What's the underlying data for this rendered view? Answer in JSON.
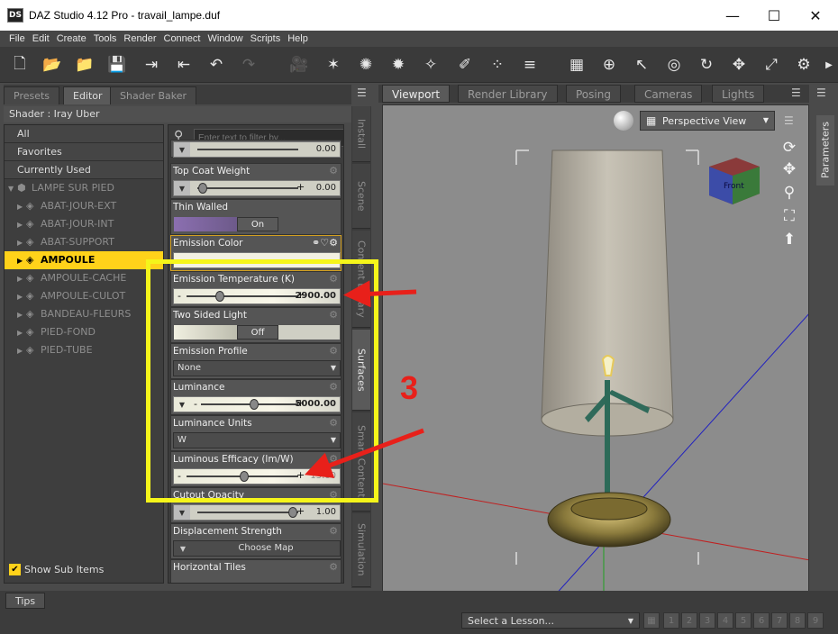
{
  "window": {
    "app_icon": "DS",
    "title": "DAZ Studio 4.12 Pro - travail_lampe.duf",
    "minimize": "—",
    "maximize": "☐",
    "close": "✕"
  },
  "menu": [
    "File",
    "Edit",
    "Create",
    "Tools",
    "Render",
    "Connect",
    "Window",
    "Scripts",
    "Help"
  ],
  "left_tabs": [
    "Presets",
    "Editor",
    "Shader Baker"
  ],
  "shader": "Shader : Iray Uber",
  "tree": {
    "headers": [
      "All",
      "Favorites",
      "Currently Used"
    ],
    "root": "LAMPE SUR PIED",
    "items": [
      "ABAT-JOUR-EXT",
      "ABAT-JOUR-INT",
      "ABAT-SUPPORT",
      "AMPOULE",
      "AMPOULE-CACHE",
      "AMPOULE-CULOT",
      "BANDEAU-FLEURS",
      "PIED-FOND",
      "PIED-TUBE"
    ],
    "selected": "AMPOULE",
    "show_sub_items": "Show Sub Items"
  },
  "filter_placeholder": "Enter text to filter by...",
  "properties": {
    "top_value": "0.00",
    "top_coat_weight": {
      "label": "Top Coat Weight",
      "value": "0.00",
      "level": 0.05
    },
    "thin_walled": {
      "label": "Thin Walled",
      "value": "On"
    },
    "emission_color": {
      "label": "Emission Color"
    },
    "emission_temperature": {
      "label": "Emission Temperature (K)",
      "value": "2900.00",
      "level": 0.3
    },
    "two_sided_light": {
      "label": "Two Sided Light",
      "value": "Off"
    },
    "emission_profile": {
      "label": "Emission Profile",
      "value": "None"
    },
    "luminance": {
      "label": "Luminance",
      "value": "5000.00",
      "level": 0.55
    },
    "luminance_units": {
      "label": "Luminance Units",
      "value": "W"
    },
    "luminous_efficacy": {
      "label": "Luminous Efficacy (lm/W)",
      "value": "15.00",
      "level": 0.52
    },
    "cutout_opacity": {
      "label": "Cutout Opacity",
      "value": "1.00",
      "level": 0.95
    },
    "displacement_strength": {
      "label": "Displacement Strength",
      "value": "Choose Map"
    },
    "horizontal_tiles": {
      "label": "Horizontal Tiles"
    }
  },
  "vertical_tabs": [
    "Install",
    "Scene",
    "Content Library",
    "Surfaces",
    "Smart Content",
    "Simulation"
  ],
  "viewport_tabs": [
    "Viewport",
    "Render Library",
    "Posing",
    "Cameras",
    "Lights"
  ],
  "camera": "Perspective View",
  "cube_label": "Front",
  "parameters_tab": "Parameters",
  "tips": "Tips",
  "lesson": "Select a Lesson...",
  "pages": [
    "1",
    "2",
    "3",
    "4",
    "5",
    "6",
    "7",
    "8",
    "9"
  ],
  "annotation": {
    "number": "3",
    "color": "#e8201a",
    "box_color": "#f5f51a"
  }
}
